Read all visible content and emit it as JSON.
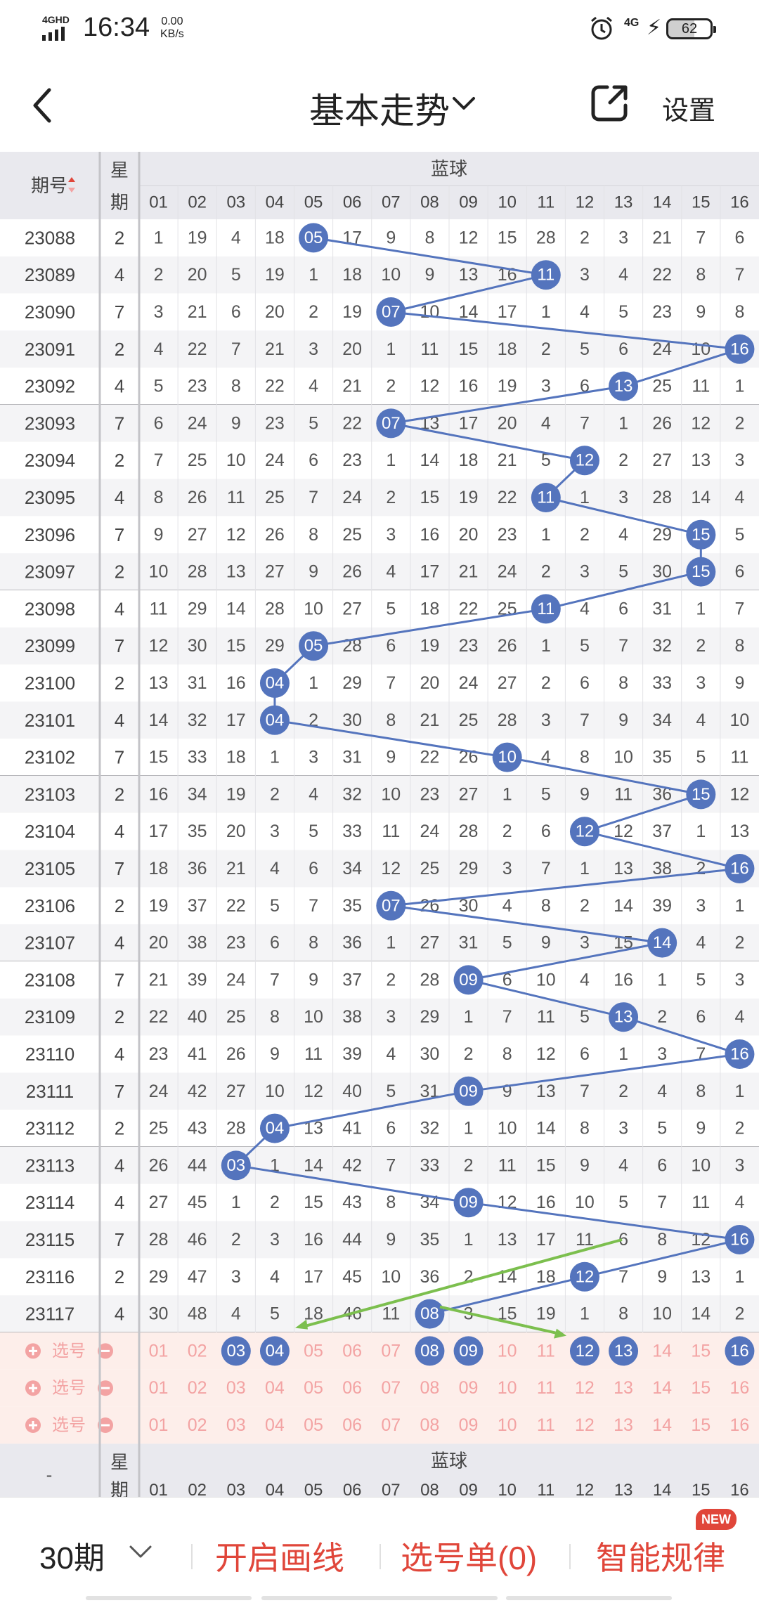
{
  "status_bar": {
    "network_gen": "4GHD",
    "time": "16:34",
    "speed_value": "0.00",
    "speed_unit": "KB/s",
    "net_type": "4G",
    "battery": "62"
  },
  "nav": {
    "title": "基本走势",
    "settings_label": "设置"
  },
  "table": {
    "col_issue": "期号",
    "col_week": "星\n期",
    "week_lines": [
      "星",
      "期"
    ],
    "blue_title": "蓝球",
    "blue_headers": [
      "01",
      "02",
      "03",
      "04",
      "05",
      "06",
      "07",
      "08",
      "09",
      "10",
      "11",
      "12",
      "13",
      "14",
      "15",
      "16"
    ],
    "rows": [
      {
        "issue": "23088",
        "week": "2",
        "cells": [
          1,
          19,
          4,
          18,
          "05",
          17,
          9,
          8,
          12,
          15,
          28,
          2,
          3,
          21,
          7,
          6
        ],
        "hit": 5
      },
      {
        "issue": "23089",
        "week": "4",
        "cells": [
          2,
          20,
          5,
          19,
          1,
          18,
          10,
          9,
          13,
          16,
          "11",
          3,
          4,
          22,
          8,
          7
        ],
        "hit": 11
      },
      {
        "issue": "23090",
        "week": "7",
        "cells": [
          3,
          21,
          6,
          20,
          2,
          19,
          "07",
          10,
          14,
          17,
          1,
          4,
          5,
          23,
          9,
          8
        ],
        "hit": 7
      },
      {
        "issue": "23091",
        "week": "2",
        "cells": [
          4,
          22,
          7,
          21,
          3,
          20,
          1,
          11,
          15,
          18,
          2,
          5,
          6,
          24,
          10,
          "16"
        ],
        "hit": 16
      },
      {
        "issue": "23092",
        "week": "4",
        "cells": [
          5,
          23,
          8,
          22,
          4,
          21,
          2,
          12,
          16,
          19,
          3,
          6,
          "13",
          25,
          11,
          1
        ],
        "hit": 13
      },
      {
        "issue": "23093",
        "week": "7",
        "cells": [
          6,
          24,
          9,
          23,
          5,
          22,
          "07",
          13,
          17,
          20,
          4,
          7,
          1,
          26,
          12,
          2
        ],
        "hit": 7
      },
      {
        "issue": "23094",
        "week": "2",
        "cells": [
          7,
          25,
          10,
          24,
          6,
          23,
          1,
          14,
          18,
          21,
          5,
          "12",
          2,
          27,
          13,
          3
        ],
        "hit": 12
      },
      {
        "issue": "23095",
        "week": "4",
        "cells": [
          8,
          26,
          11,
          25,
          7,
          24,
          2,
          15,
          19,
          22,
          "11",
          1,
          3,
          28,
          14,
          4
        ],
        "hit": 11
      },
      {
        "issue": "23096",
        "week": "7",
        "cells": [
          9,
          27,
          12,
          26,
          8,
          25,
          3,
          16,
          20,
          23,
          1,
          2,
          4,
          29,
          "15",
          5
        ],
        "hit": 15
      },
      {
        "issue": "23097",
        "week": "2",
        "cells": [
          10,
          28,
          13,
          27,
          9,
          26,
          4,
          17,
          21,
          24,
          2,
          3,
          5,
          30,
          "15",
          6
        ],
        "hit": 15
      },
      {
        "issue": "23098",
        "week": "4",
        "cells": [
          11,
          29,
          14,
          28,
          10,
          27,
          5,
          18,
          22,
          25,
          "11",
          4,
          6,
          31,
          1,
          7
        ],
        "hit": 11
      },
      {
        "issue": "23099",
        "week": "7",
        "cells": [
          12,
          30,
          15,
          29,
          "05",
          28,
          6,
          19,
          23,
          26,
          1,
          5,
          7,
          32,
          2,
          8
        ],
        "hit": 5
      },
      {
        "issue": "23100",
        "week": "2",
        "cells": [
          13,
          31,
          16,
          "04",
          1,
          29,
          7,
          20,
          24,
          27,
          2,
          6,
          8,
          33,
          3,
          9
        ],
        "hit": 4
      },
      {
        "issue": "23101",
        "week": "4",
        "cells": [
          14,
          32,
          17,
          "04",
          2,
          30,
          8,
          21,
          25,
          28,
          3,
          7,
          9,
          34,
          4,
          10
        ],
        "hit": 4
      },
      {
        "issue": "23102",
        "week": "7",
        "cells": [
          15,
          33,
          18,
          1,
          3,
          31,
          9,
          22,
          26,
          "10",
          4,
          8,
          10,
          35,
          5,
          11
        ],
        "hit": 10
      },
      {
        "issue": "23103",
        "week": "2",
        "cells": [
          16,
          34,
          19,
          2,
          4,
          32,
          10,
          23,
          27,
          1,
          5,
          9,
          11,
          36,
          "15",
          12
        ],
        "hit": 15
      },
      {
        "issue": "23104",
        "week": "4",
        "cells": [
          17,
          35,
          20,
          3,
          5,
          33,
          11,
          24,
          28,
          2,
          6,
          "12",
          12,
          37,
          1,
          13
        ],
        "hit": 12
      },
      {
        "issue": "23105",
        "week": "7",
        "cells": [
          18,
          36,
          21,
          4,
          6,
          34,
          12,
          25,
          29,
          3,
          7,
          1,
          13,
          38,
          2,
          "16"
        ],
        "hit": 16
      },
      {
        "issue": "23106",
        "week": "2",
        "cells": [
          19,
          37,
          22,
          5,
          7,
          35,
          "07",
          26,
          30,
          4,
          8,
          2,
          14,
          39,
          3,
          1
        ],
        "hit": 7
      },
      {
        "issue": "23107",
        "week": "4",
        "cells": [
          20,
          38,
          23,
          6,
          8,
          36,
          1,
          27,
          31,
          5,
          9,
          3,
          15,
          "14",
          4,
          2
        ],
        "hit": 14
      },
      {
        "issue": "23108",
        "week": "7",
        "cells": [
          21,
          39,
          24,
          7,
          9,
          37,
          2,
          28,
          "09",
          6,
          10,
          4,
          16,
          1,
          5,
          3
        ],
        "hit": 9
      },
      {
        "issue": "23109",
        "week": "2",
        "cells": [
          22,
          40,
          25,
          8,
          10,
          38,
          3,
          29,
          1,
          7,
          11,
          5,
          "13",
          2,
          6,
          4
        ],
        "hit": 13
      },
      {
        "issue": "23110",
        "week": "4",
        "cells": [
          23,
          41,
          26,
          9,
          11,
          39,
          4,
          30,
          2,
          8,
          12,
          6,
          1,
          3,
          7,
          "16"
        ],
        "hit": 16
      },
      {
        "issue": "23111",
        "week": "7",
        "cells": [
          24,
          42,
          27,
          10,
          12,
          40,
          5,
          31,
          "09",
          9,
          13,
          7,
          2,
          4,
          8,
          1
        ],
        "hit": 9
      },
      {
        "issue": "23112",
        "week": "2",
        "cells": [
          25,
          43,
          28,
          "04",
          13,
          41,
          6,
          32,
          1,
          10,
          14,
          8,
          3,
          5,
          9,
          2
        ],
        "hit": 4
      },
      {
        "issue": "23113",
        "week": "4",
        "cells": [
          26,
          44,
          "03",
          1,
          14,
          42,
          7,
          33,
          2,
          11,
          15,
          9,
          4,
          6,
          10,
          3
        ],
        "hit": 3
      },
      {
        "issue": "23114",
        "week": "4",
        "cells": [
          27,
          45,
          1,
          2,
          15,
          43,
          8,
          34,
          "09",
          12,
          16,
          10,
          5,
          7,
          11,
          4
        ],
        "hit": 9
      },
      {
        "issue": "23115",
        "week": "7",
        "cells": [
          28,
          46,
          2,
          3,
          16,
          44,
          9,
          35,
          1,
          13,
          17,
          11,
          6,
          8,
          12,
          "16"
        ],
        "hit": 16
      },
      {
        "issue": "23116",
        "week": "2",
        "cells": [
          29,
          47,
          3,
          4,
          17,
          45,
          10,
          36,
          2,
          14,
          18,
          "12",
          7,
          9,
          13,
          1
        ],
        "hit": 12
      },
      {
        "issue": "23117",
        "week": "4",
        "cells": [
          30,
          48,
          4,
          5,
          18,
          46,
          11,
          "08",
          3,
          15,
          19,
          1,
          8,
          10,
          14,
          2
        ],
        "hit": 8
      }
    ],
    "select_label": "选号",
    "select_rows": [
      {
        "selected": [
          3,
          4,
          8,
          9,
          12,
          13,
          16
        ]
      },
      {
        "selected": []
      },
      {
        "selected": []
      }
    ],
    "footer_issue": "-",
    "footer_blue": "蓝球"
  },
  "colors": {
    "ball": "#5474bd",
    "line": "#5474bd",
    "green": "#7cbf4e",
    "pink": "#f3a3a3",
    "pinkbg": "#fdeeea",
    "header_bg": "#e9e9ee",
    "red": "#e0463a"
  },
  "bottom": {
    "periods": "30期",
    "draw_line": "开启画线",
    "selection": "选号单(0)",
    "smart": "智能规律",
    "new_badge": "NEW"
  }
}
